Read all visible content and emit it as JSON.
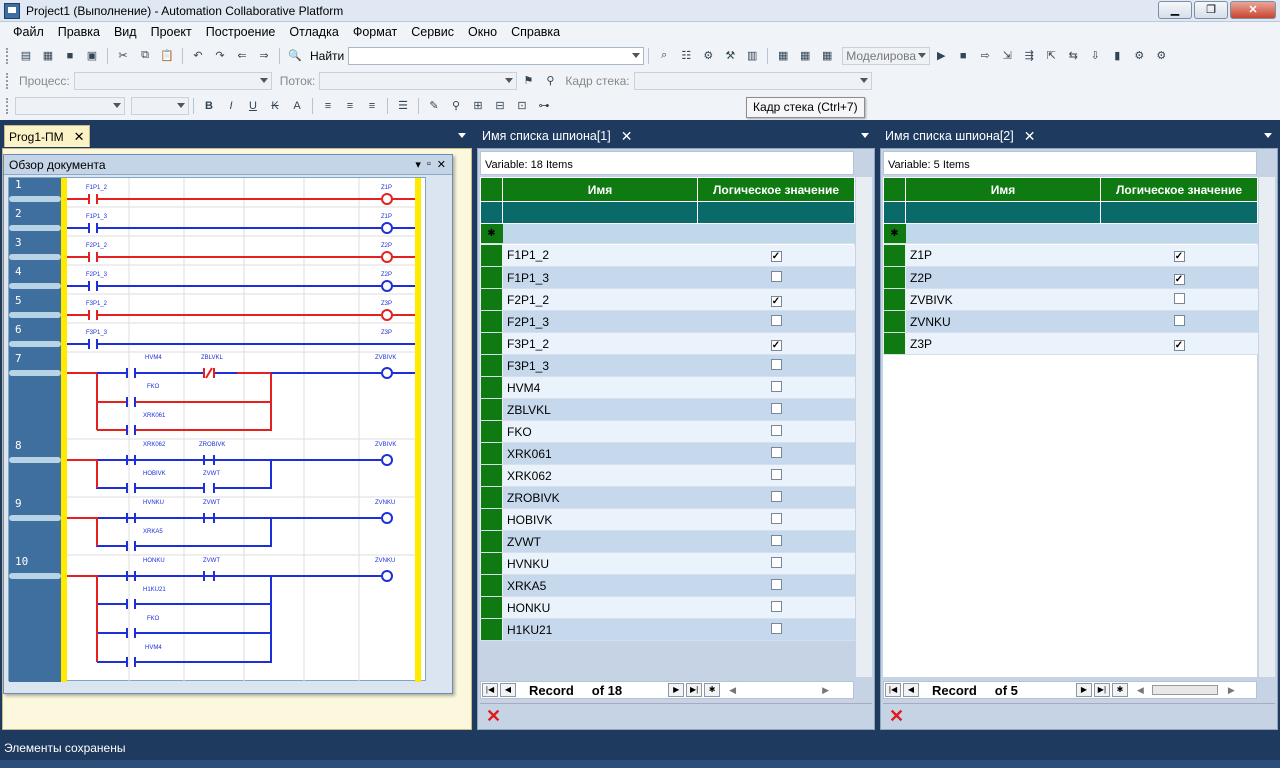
{
  "window": {
    "title": "Project1 (Выполнение) - Automation Collaborative Platform"
  },
  "menu": [
    "Файл",
    "Правка",
    "Вид",
    "Проект",
    "Построение",
    "Отладка",
    "Формат",
    "Сервис",
    "Окно",
    "Справка"
  ],
  "toolbar": {
    "find_label": "Найти",
    "find_value": "",
    "sim_mode": "Моделирова",
    "process_label": "Процесс:",
    "thread_label": "Поток:",
    "stackframe_label": "Кадр стека:"
  },
  "tooltip": "Кадр стека (Ctrl+7)",
  "editor_tab": {
    "label": "Prog1-ПМ"
  },
  "overview": {
    "title": "Обзор документа",
    "rungs": [
      "1",
      "2",
      "3",
      "4",
      "5",
      "6",
      "7",
      "8",
      "9",
      "10"
    ]
  },
  "ladder_labels": {
    "r1": [
      "F1P1_2",
      "Z1P"
    ],
    "r2": [
      "F1P1_3",
      "Z1P"
    ],
    "r3": [
      "F2P1_2",
      "Z2P"
    ],
    "r4": [
      "F2P1_3",
      "Z2P"
    ],
    "r5": [
      "F3P1_2",
      "Z3P"
    ],
    "r6": [
      "F3P1_3",
      "Z3P"
    ],
    "r7": [
      "HVM4",
      "ZBLVKL",
      "ZVBIVK",
      "FKO",
      "XRK061"
    ],
    "r8": [
      "XRK062",
      "ZROBIVK",
      "ZVBIVK",
      "HOBIVK",
      "ZVWT"
    ],
    "r9": [
      "HVNKU",
      "ZVWT",
      "ZVNKU",
      "XRKA5"
    ],
    "r10": [
      "HONKU",
      "ZVWT",
      "ZVNKU",
      "H1KU21",
      "FKO",
      "HVM4"
    ]
  },
  "watch1": {
    "tab": "Имя списка шпиона[1]",
    "info": "Variable: 18 Items",
    "col_name": "Имя",
    "col_value": "Логическое значение",
    "rows": [
      {
        "name": "F1P1_2",
        "checked": true
      },
      {
        "name": "F1P1_3",
        "checked": false
      },
      {
        "name": "F2P1_2",
        "checked": true
      },
      {
        "name": "F2P1_3",
        "checked": false
      },
      {
        "name": "F3P1_2",
        "checked": true
      },
      {
        "name": "F3P1_3",
        "checked": false
      },
      {
        "name": "HVM4",
        "checked": false
      },
      {
        "name": "ZBLVKL",
        "checked": false
      },
      {
        "name": "FKO",
        "checked": false
      },
      {
        "name": "XRK061",
        "checked": false
      },
      {
        "name": "XRK062",
        "checked": false
      },
      {
        "name": "ZROBIVK",
        "checked": false
      },
      {
        "name": "HOBIVK",
        "checked": false
      },
      {
        "name": "ZVWT",
        "checked": false
      },
      {
        "name": "HVNKU",
        "checked": false
      },
      {
        "name": "XRKA5",
        "checked": false
      },
      {
        "name": "HONKU",
        "checked": false
      },
      {
        "name": "H1KU21",
        "checked": false
      }
    ],
    "record_label": "Record",
    "record_of": "of 18"
  },
  "watch2": {
    "tab": "Имя списка шпиона[2]",
    "info": "Variable: 5 Items",
    "col_name": "Имя",
    "col_value": "Логическое значение",
    "rows": [
      {
        "name": "Z1P",
        "checked": true
      },
      {
        "name": "Z2P",
        "checked": true
      },
      {
        "name": "ZVBIVK",
        "checked": false
      },
      {
        "name": "ZVNKU",
        "checked": false
      },
      {
        "name": "Z3P",
        "checked": true
      }
    ],
    "record_label": "Record",
    "record_of": "of 5"
  },
  "status": "Элементы сохранены"
}
